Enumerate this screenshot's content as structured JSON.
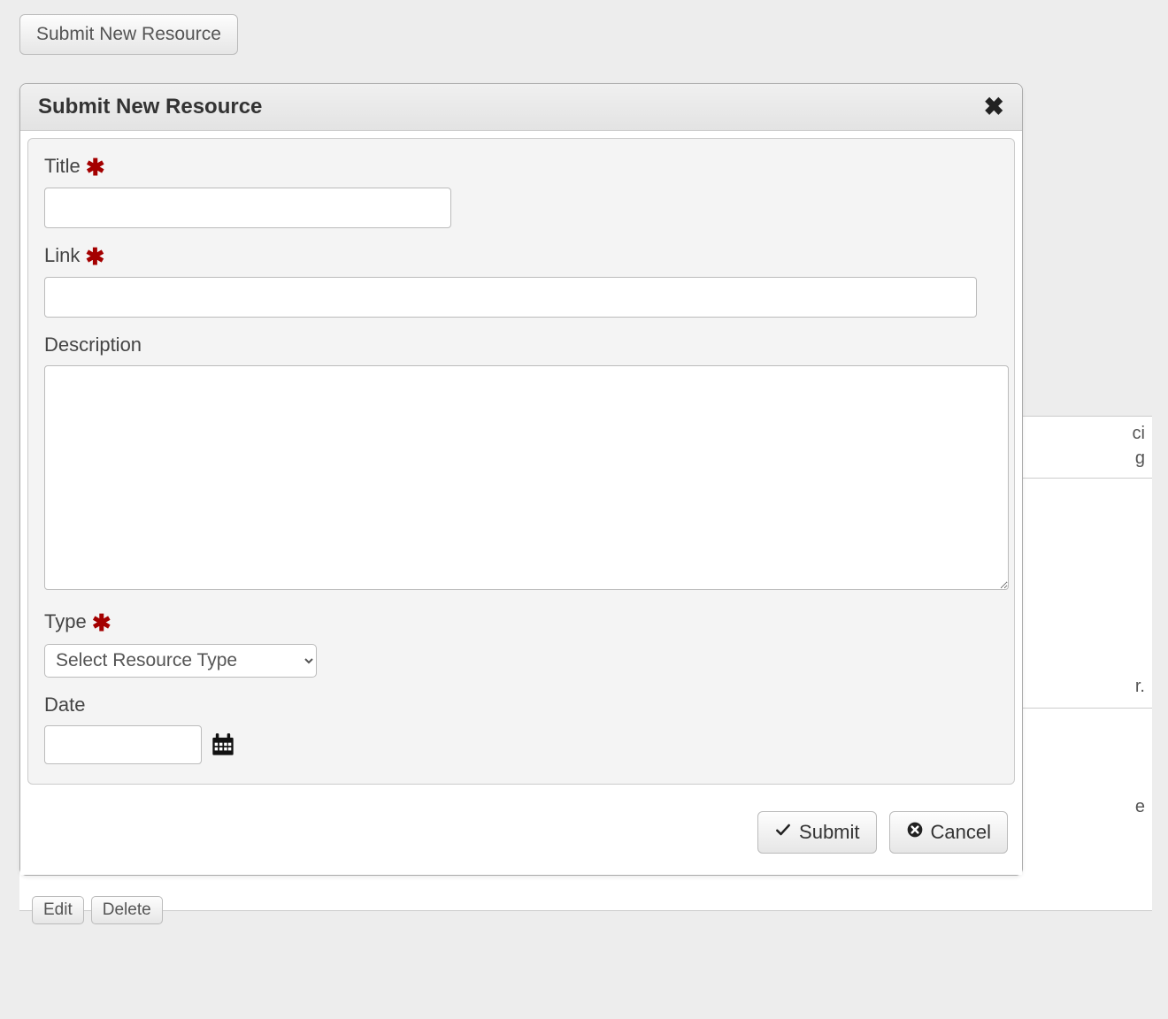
{
  "top_button_label": "Submit New Resource",
  "dialog": {
    "title": "Submit New Resource",
    "fields": {
      "title": {
        "label": "Title",
        "required": true,
        "value": ""
      },
      "link": {
        "label": "Link",
        "required": true,
        "value": ""
      },
      "description": {
        "label": "Description",
        "required": false,
        "value": ""
      },
      "type": {
        "label": "Type",
        "required": true,
        "selected": "Select Resource Type"
      },
      "date": {
        "label": "Date",
        "required": false,
        "value": ""
      }
    },
    "footer": {
      "submit_label": "Submit",
      "cancel_label": "Cancel"
    }
  },
  "background": {
    "edit_label": "Edit",
    "delete_label": "Delete",
    "snippet_1a": "ci",
    "snippet_1b": "g",
    "snippet_2": "r.",
    "snippet_3": "e"
  },
  "required_asterisk": "✱"
}
